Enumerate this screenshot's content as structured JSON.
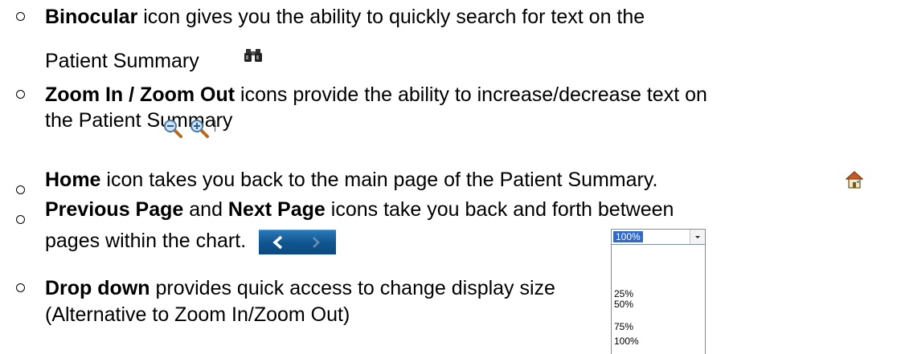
{
  "items": [
    {
      "bold": "Binocular",
      "text": " icon gives you the ability to quickly search for text on the",
      "line2": "Patient Summary"
    },
    {
      "bold": "Zoom In / Zoom Out",
      "text": " icons provide the ability to increase/decrease text on",
      "line2": "the Patient Summary"
    },
    {
      "bold": "Home",
      "text": " icon takes you back to the main page of the Patient Summary."
    },
    {
      "bold": "Previous Page",
      "mid": " and ",
      "bold2": "Next Page",
      "text": " icons take you back and forth between",
      "line2": "pages within the chart."
    },
    {
      "bold": "Drop down",
      "text": " provides quick access to change display size",
      "line2": "(Alternative to Zoom In/Zoom Out)"
    }
  ],
  "dropdown": {
    "selected": "100%",
    "options": [
      "25%",
      "50%",
      "75%",
      "100%"
    ]
  },
  "icons": {
    "binoculars": "binoculars-icon",
    "zoom_out": "zoom-out-icon",
    "zoom_in": "zoom-in-icon",
    "home": "home-icon",
    "prev": "previous-page-icon",
    "next": "next-page-icon"
  },
  "colors": {
    "nav_bar": "#10548e",
    "selection": "#3169c6"
  }
}
